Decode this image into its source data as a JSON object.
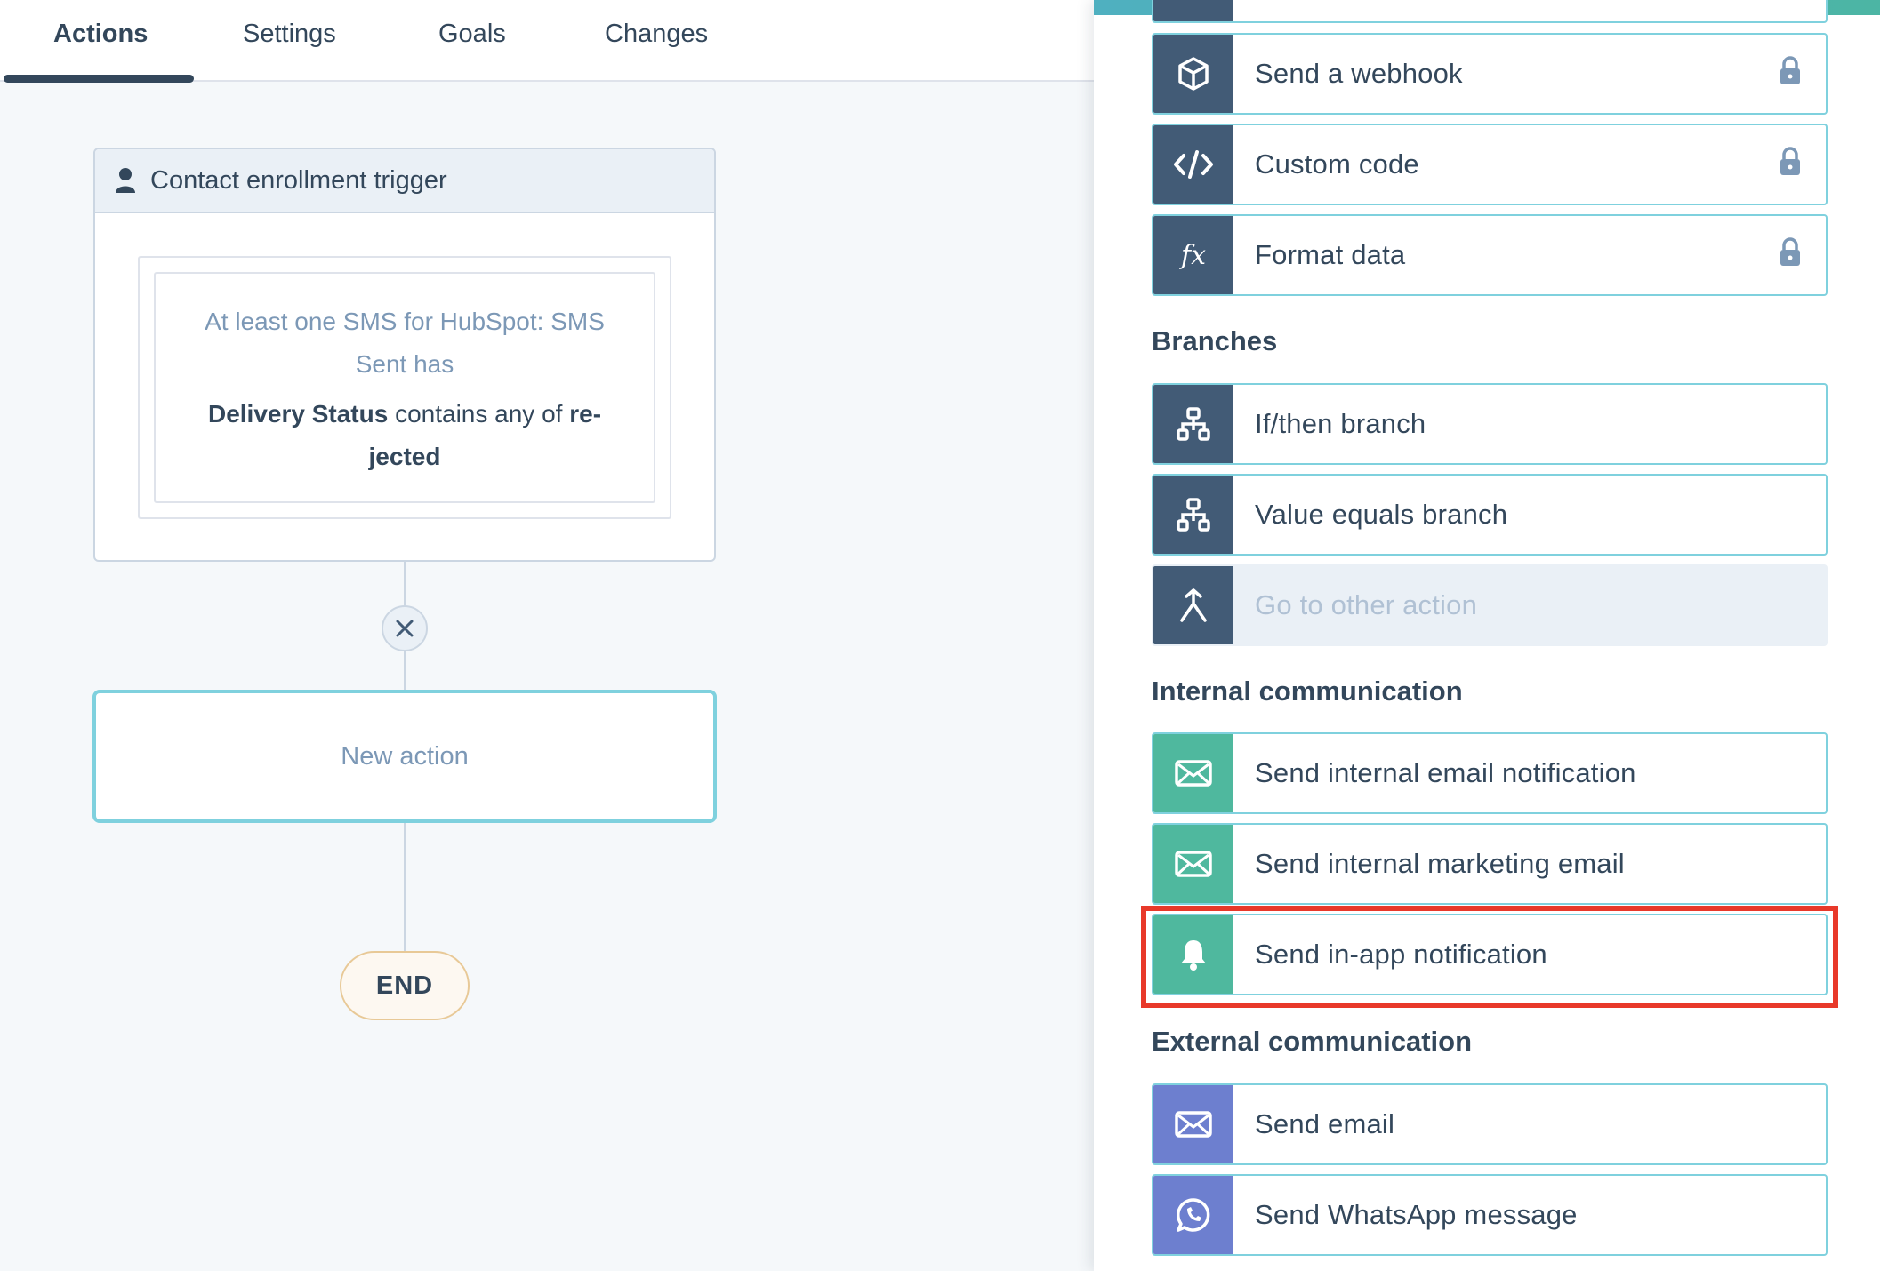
{
  "tabs": [
    {
      "label": "Actions",
      "active": true
    },
    {
      "label": "Settings",
      "active": false
    },
    {
      "label": "Goals",
      "active": false
    },
    {
      "label": "Changes",
      "active": false
    }
  ],
  "trigger": {
    "icon": "person-icon",
    "title": "Contact enrollment trigger",
    "filter_line1": "At least one SMS for HubSpot: SMS",
    "filter_line2": "Sent has",
    "filter_property": "Delivery Status",
    "filter_operator": " contains any of ",
    "filter_value_part1": "re-",
    "filter_value_part2": "jected"
  },
  "new_action": {
    "label": "New action"
  },
  "end": {
    "label": "END"
  },
  "panel": {
    "data_ops": [
      {
        "label": "Send a webhook",
        "icon": "cube-icon",
        "locked": true
      },
      {
        "label": "Custom code",
        "icon": "code-icon",
        "locked": true
      },
      {
        "label": "Format data",
        "icon": "fx-icon",
        "icon_text": "fx",
        "locked": true
      }
    ],
    "branches": {
      "title": "Branches",
      "items": [
        {
          "label": "If/then branch",
          "icon": "branch-icon"
        },
        {
          "label": "Value equals branch",
          "icon": "branch-icon"
        },
        {
          "label": "Go to other action",
          "icon": "merge-arrow-icon",
          "disabled": true
        }
      ]
    },
    "internal": {
      "title": "Internal communication",
      "items": [
        {
          "label": "Send internal email notification",
          "icon": "envelope-icon"
        },
        {
          "label": "Send internal marketing email",
          "icon": "envelope-icon"
        },
        {
          "label": "Send in-app notification",
          "icon": "bell-icon",
          "highlighted": true
        }
      ]
    },
    "external": {
      "title": "External communication",
      "items": [
        {
          "label": "Send email",
          "icon": "envelope-icon"
        },
        {
          "label": "Send WhatsApp message",
          "icon": "whatsapp-icon"
        }
      ]
    }
  },
  "colors": {
    "dark_icon_bg": "#425b76",
    "green_icon_bg": "#4fb89e",
    "purple_icon_bg": "#6d7fcf",
    "card_border": "#7fd1de",
    "highlight": "#e8392a"
  }
}
